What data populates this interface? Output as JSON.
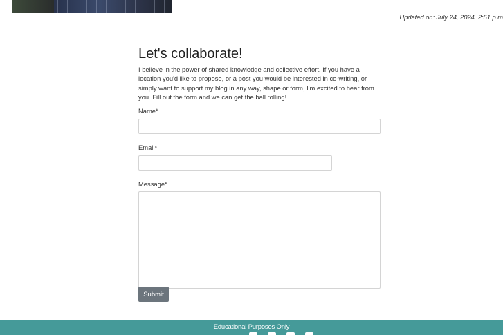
{
  "header": {
    "updated_text": "Updated on: July 24, 2024, 2:51 p.m"
  },
  "contact": {
    "title": "Let's collaborate!",
    "intro": "I believe in the power of shared knowledge and collective effort. If you have a location you'd like to propose, or a post you would be interested in co-writing, or simply want to support my blog in any way, shape or form, I'm excited to hear from you. Fill out the form and we can get the ball rolling!",
    "name_label": "Name*",
    "name_value": "",
    "email_label": "Email*",
    "email_value": "",
    "message_label": "Message*",
    "message_value": "",
    "submit_label": "Submit"
  },
  "footer": {
    "text": "Educational Purposes Only",
    "social_icons": [
      "facebook-icon",
      "twitter-icon",
      "instagram-icon",
      "youtube-icon"
    ]
  },
  "colors": {
    "footer_bg": "#459a99",
    "submit_bg": "#6c757d"
  }
}
